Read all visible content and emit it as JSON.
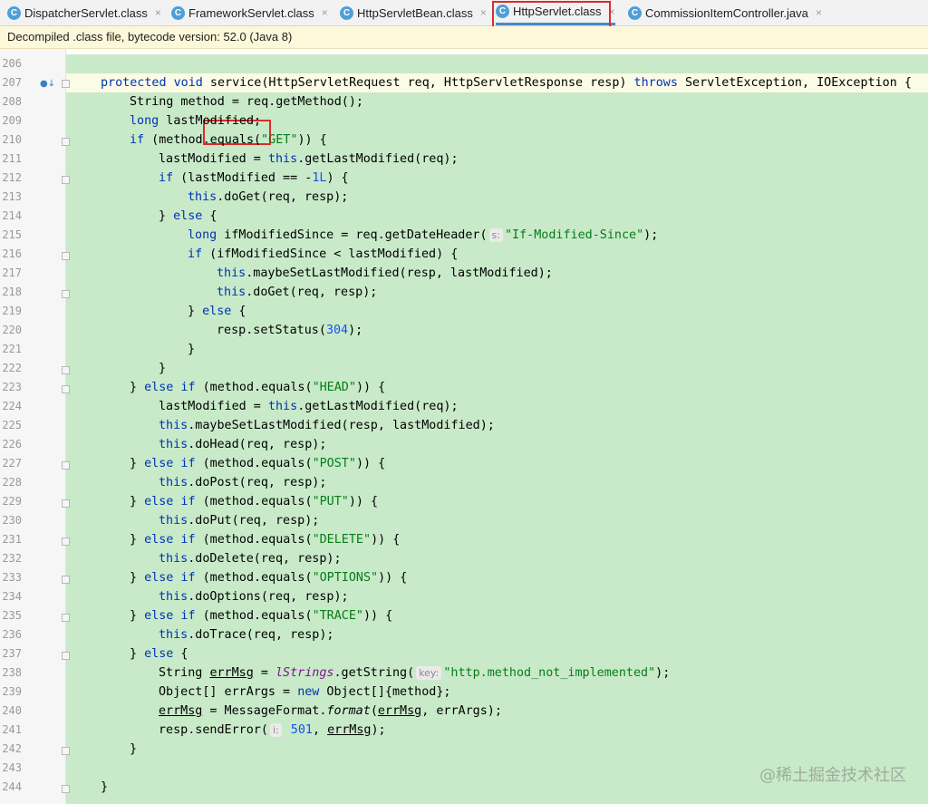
{
  "tabs": [
    {
      "label": "DispatcherServlet.class",
      "active": false,
      "icon": "class-file-icon"
    },
    {
      "label": "FrameworkServlet.class",
      "active": false,
      "icon": "class-file-icon"
    },
    {
      "label": "HttpServletBean.class",
      "active": false,
      "icon": "class-file-icon"
    },
    {
      "label": "HttpServlet.class",
      "active": true,
      "icon": "class-file-icon"
    },
    {
      "label": "CommissionItemController.java",
      "active": false,
      "icon": "java-class-icon"
    }
  ],
  "tab_icon_letter": "C",
  "close_glyph": "×",
  "banner": "Decompiled .class file, bytecode version: 52.0 (Java 8)",
  "line_numbers": [
    "206",
    "207",
    "208",
    "209",
    "210",
    "211",
    "212",
    "213",
    "214",
    "215",
    "216",
    "217",
    "218",
    "219",
    "220",
    "221",
    "222",
    "223",
    "224",
    "225",
    "226",
    "227",
    "228",
    "229",
    "230",
    "231",
    "232",
    "233",
    "234",
    "235",
    "236",
    "237",
    "238",
    "239",
    "240",
    "241",
    "242",
    "243",
    "244"
  ],
  "watermark": "@稀土掘金技术社区",
  "colors": {
    "code_background": "#c8eac9",
    "highlight_box": "#e12a2a",
    "keyword": "#0033b3",
    "string": "#067d17",
    "number": "#1750eb"
  }
}
